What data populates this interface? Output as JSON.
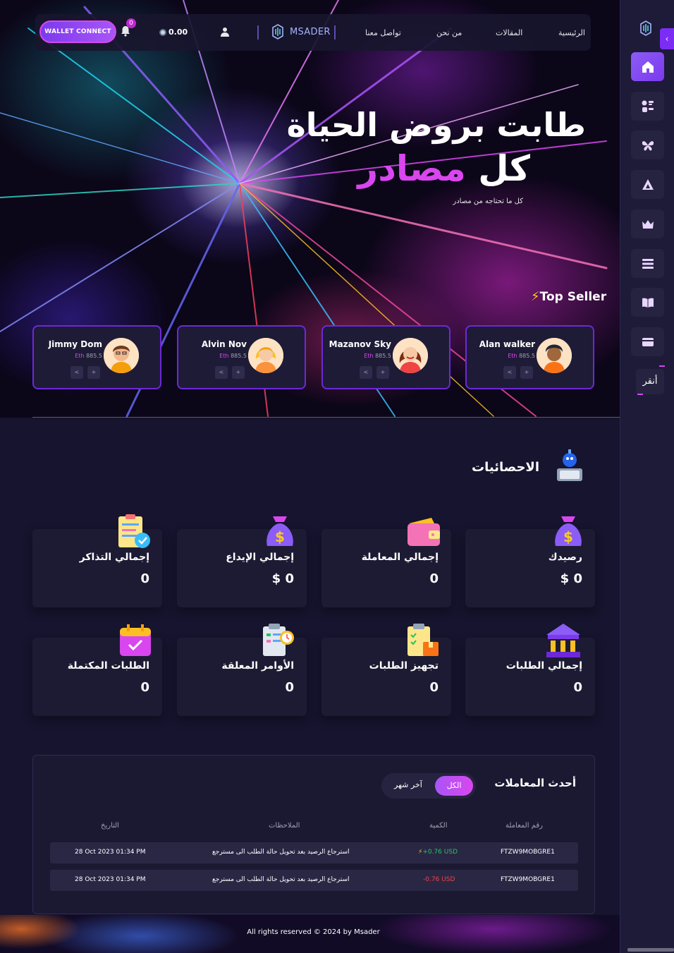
{
  "nav": {
    "wallet_connect": "WALLET CONNECT",
    "notification_count": "0",
    "balance": "0.00",
    "brand": "MSADER",
    "links": [
      "تواصل معنا",
      "من نحن",
      "المقالات",
      "الرئيسية"
    ]
  },
  "hero": {
    "title_line1": "طابت بروض الحياة",
    "title_line2_plain": "كل",
    "title_line2_accent": "مصادر",
    "subtitle": "كل ما تحتاجه من مصادر"
  },
  "top_seller": {
    "heading": "Top Seller",
    "sellers": [
      {
        "name": "Jimmy Dom",
        "currency": "Eth",
        "price": "885.5"
      },
      {
        "name": "Alvin Nov",
        "currency": "Eth",
        "price": "885.5"
      },
      {
        "name": "Mazanov Sky",
        "currency": "Eth",
        "price": "885.5"
      },
      {
        "name": "Alan walker",
        "currency": "Eth",
        "price": "885.5"
      }
    ]
  },
  "stats": {
    "title": "الاحصائيات",
    "cards": [
      {
        "label": "إجمالي التذاكر",
        "value": "0",
        "icon": "ticket-clipboard-icon"
      },
      {
        "label": "إجمالي الإيداع",
        "value": "0 $",
        "icon": "money-bag-icon"
      },
      {
        "label": "إجمالي المعاملة",
        "value": "0",
        "icon": "wallet-icon"
      },
      {
        "label": "رصيدك",
        "value": "0 $",
        "icon": "money-bag-icon"
      },
      {
        "label": "الطلبات المكتملة",
        "value": "0",
        "icon": "calendar-check-icon"
      },
      {
        "label": "الأوامر المعلقة",
        "value": "0",
        "icon": "clipboard-clock-icon"
      },
      {
        "label": "تجهيز الطلبات",
        "value": "0",
        "icon": "clipboard-box-icon"
      },
      {
        "label": "إجمالي الطلبات",
        "value": "0",
        "icon": "bank-icon"
      }
    ]
  },
  "transactions": {
    "title": "أحدث المعاملات",
    "filter_all": "الكل",
    "filter_month": "آخر شهر",
    "columns": {
      "id": "رقم المعاملة",
      "amount": "الكمية",
      "notes": "الملاحظات",
      "date": "التاريخ"
    },
    "rows": [
      {
        "id": "FTZW9MOBGRE1",
        "amount": "+0.76 USD",
        "positive": true,
        "note": "استرجاع الرصيد بعد تحويل حالة الطلب الى مسترجع",
        "date": "28 Oct 2023 01:34 PM"
      },
      {
        "id": "FTZW9MOBGRE1",
        "amount": "-0.76 USD",
        "positive": false,
        "note": "استرجاع الرصيد بعد تحويل حالة الطلب الى مسترجع",
        "date": "28 Oct 2023 01:34 PM"
      }
    ]
  },
  "sidebar": {
    "collapse_icon": "chevron-left-icon",
    "items": [
      "home-icon",
      "apps-icon",
      "butterfly-icon",
      "triangle-icon",
      "crown-icon",
      "list-icon",
      "book-icon",
      "card-icon"
    ],
    "text_button": "أنقر"
  },
  "footer": {
    "text": "All rights reserved © 2024 by Msader"
  },
  "colors": {
    "accent": "#d946ef",
    "primary": "#7c3aed",
    "panel": "#1d1b34",
    "positive": "#22c55e",
    "negative": "#ef4444"
  }
}
